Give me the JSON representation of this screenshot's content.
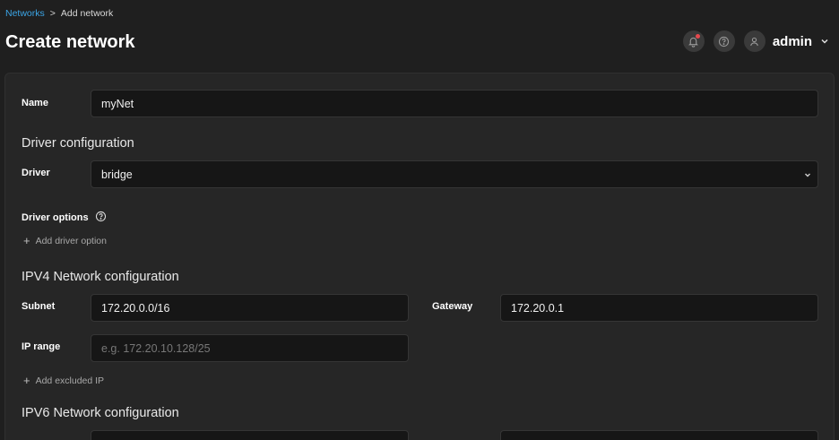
{
  "breadcrumb": {
    "parent": "Networks",
    "separator": ">",
    "current": "Add network"
  },
  "page": {
    "title": "Create network"
  },
  "header": {
    "username": "admin",
    "icons": [
      "notification-bell-icon",
      "help-icon",
      "user-icon",
      "chevron-down-icon"
    ],
    "notification_dot_color": "#e5484d"
  },
  "form": {
    "name": {
      "label": "Name",
      "value": "myNet"
    },
    "driver_section": {
      "title": "Driver configuration",
      "driver_label": "Driver",
      "driver_value": "bridge",
      "options_label": "Driver options",
      "add_option_label": "Add driver option"
    },
    "ipv4": {
      "title": "IPV4 Network configuration",
      "subnet_label": "Subnet",
      "subnet_value": "172.20.0.0/16",
      "gateway_label": "Gateway",
      "gateway_value": "172.20.0.1",
      "ip_range_label": "IP range",
      "ip_range_placeholder": "e.g. 172.20.10.128/25",
      "add_excluded_label": "Add excluded IP"
    },
    "ipv6": {
      "title": "IPV6 Network configuration"
    }
  },
  "colors": {
    "background": "#1f1f1f",
    "panel": "#262626",
    "input": "#161616",
    "link": "#3ba5e6"
  }
}
